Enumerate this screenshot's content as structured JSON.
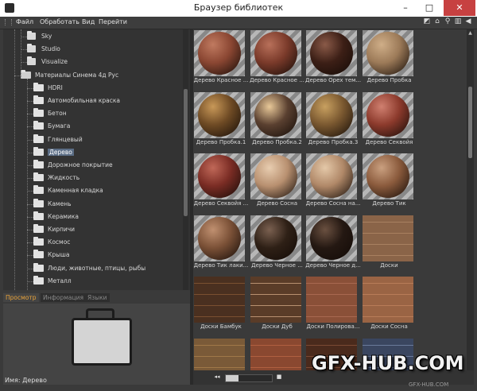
{
  "window": {
    "title": "Браузер библиотек",
    "minimize": "–",
    "maximize": "□",
    "close": "✕"
  },
  "menu": [
    "Файл",
    "Обработать",
    "Вид",
    "Перейти"
  ],
  "toolbar_icons": [
    "new-icon",
    "home-icon",
    "search-icon",
    "view-icon",
    "back-icon"
  ],
  "tree": [
    {
      "label": "Sky",
      "depth": 2,
      "icon": "db"
    },
    {
      "label": "Studio",
      "depth": 2,
      "icon": "db"
    },
    {
      "label": "Visualize",
      "depth": 2,
      "icon": "db"
    },
    {
      "label": "Материалы Синема 4д Рус",
      "depth": 1,
      "icon": "folder-open"
    },
    {
      "label": "HDRI",
      "depth": 3,
      "icon": "folder"
    },
    {
      "label": "Автомобильная краска",
      "depth": 3,
      "icon": "folder"
    },
    {
      "label": "Бетон",
      "depth": 3,
      "icon": "folder"
    },
    {
      "label": "Бумага",
      "depth": 3,
      "icon": "folder"
    },
    {
      "label": "Глянцевый",
      "depth": 3,
      "icon": "folder"
    },
    {
      "label": "Дерево",
      "depth": 3,
      "icon": "folder",
      "selected": true
    },
    {
      "label": "Дорожное покрытие",
      "depth": 3,
      "icon": "folder"
    },
    {
      "label": "Жидкость",
      "depth": 3,
      "icon": "folder"
    },
    {
      "label": "Каменная кладка",
      "depth": 3,
      "icon": "folder"
    },
    {
      "label": "Камень",
      "depth": 3,
      "icon": "folder"
    },
    {
      "label": "Керамика",
      "depth": 3,
      "icon": "folder"
    },
    {
      "label": "Кирпичи",
      "depth": 3,
      "icon": "folder"
    },
    {
      "label": "Космос",
      "depth": 3,
      "icon": "folder"
    },
    {
      "label": "Крыша",
      "depth": 3,
      "icon": "folder"
    },
    {
      "label": "Люди, животные, птицы, рыбы",
      "depth": 3,
      "icon": "folder"
    },
    {
      "label": "Металл",
      "depth": 3,
      "icon": "folder"
    }
  ],
  "tabs": [
    {
      "label": "Просмотр",
      "active": true
    },
    {
      "label": "Информация",
      "active": false
    },
    {
      "label": "Языки",
      "active": false
    }
  ],
  "preview": {
    "name_label": "Имя: Дерево"
  },
  "materials": [
    {
      "label": "Дерево Красное ...",
      "kind": "sphere",
      "color": "#8a4632",
      "hl": "#c07a60"
    },
    {
      "label": "Дерево Красное ...",
      "kind": "sphere",
      "color": "#7a3a2a",
      "hl": "#b8705a"
    },
    {
      "label": "Дерево Орех тем...",
      "kind": "sphere",
      "color": "#3c1f16",
      "hl": "#8a5a48"
    },
    {
      "label": "Дерево Пробка",
      "kind": "sphere",
      "color": "#9c7a58",
      "hl": "#cfae88"
    },
    {
      "label": "Дерево Пробка.1",
      "kind": "sphere",
      "color": "#6e4a24",
      "hl": "#c89858"
    },
    {
      "label": "Дерево Пробка.2",
      "kind": "sphere",
      "color": "#5a4030",
      "hl": "#e8c898"
    },
    {
      "label": "Дерево Пробка.3",
      "kind": "sphere",
      "color": "#7a5830",
      "hl": "#c8a060"
    },
    {
      "label": "Дерево Секвойя",
      "kind": "sphere",
      "color": "#8c3a2c",
      "hl": "#d08070"
    },
    {
      "label": "Дерево Секвойя ...",
      "kind": "sphere",
      "color": "#7a2c24",
      "hl": "#c06858"
    },
    {
      "label": "Дерево Сосна",
      "kind": "sphere",
      "color": "#b89070",
      "hl": "#e8cdb0"
    },
    {
      "label": "Дерево Сосна на...",
      "kind": "sphere",
      "color": "#b08868",
      "hl": "#e4c8a8"
    },
    {
      "label": "Дерево Тик",
      "kind": "sphere",
      "color": "#8a5a3c",
      "hl": "#caa080"
    },
    {
      "label": "Дерево Тик лаки...",
      "kind": "sphere",
      "color": "#7a5036",
      "hl": "#c09070"
    },
    {
      "label": "Дерево Черное ...",
      "kind": "sphere",
      "color": "#2e2016",
      "hl": "#7a6050"
    },
    {
      "label": "Дерево Черное д...",
      "kind": "sphere",
      "color": "#241812",
      "hl": "#6a5040"
    },
    {
      "label": "Доски",
      "kind": "plank",
      "color": "#8a6448",
      "hl": "#a88060"
    },
    {
      "label": "Доски Бамбук",
      "kind": "plank",
      "color": "#4a3020",
      "hl": "#7a5030"
    },
    {
      "label": "Доски Дуб",
      "kind": "plank",
      "color": "#5a3c28",
      "hl": "#b89070"
    },
    {
      "label": "Доски Полирова...",
      "kind": "plank",
      "color": "#8a5038",
      "hl": "#a86850"
    },
    {
      "label": "Доски Сосна",
      "kind": "plank",
      "color": "#9a6444",
      "hl": "#b87c58"
    },
    {
      "label": "",
      "kind": "plank",
      "color": "#7a5a38",
      "hl": "#a07848"
    },
    {
      "label": "",
      "kind": "plank",
      "color": "#8a4830",
      "hl": "#b06040"
    },
    {
      "label": "",
      "kind": "plank",
      "color": "#4a2a1c",
      "hl": "#7a4a34"
    },
    {
      "label": "",
      "kind": "plank",
      "color": "#3a4660",
      "hl": "#6a7a9a"
    }
  ],
  "watermark": "GFX-HUB.COM",
  "watermark_sub": "GFX-HUB.COM"
}
